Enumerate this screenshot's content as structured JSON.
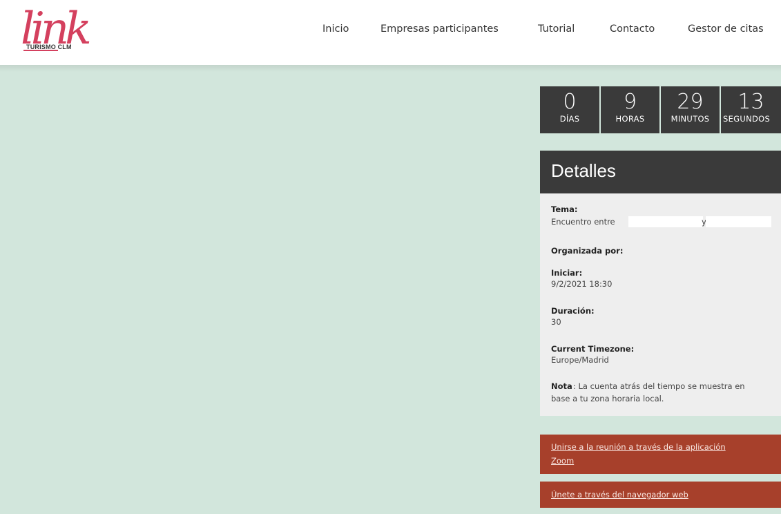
{
  "logo": {
    "script_text": "link",
    "sub_text": "TURISMO CLM"
  },
  "nav": {
    "items": [
      "Inicio",
      "Empresas participantes",
      "Tutorial",
      "Contacto",
      "Gestor de citas"
    ]
  },
  "countdown": {
    "cells": [
      {
        "value": "0",
        "label": "DÍAS"
      },
      {
        "value": "9",
        "label": "HORAS"
      },
      {
        "value": "29",
        "label": "MINUTOS"
      },
      {
        "value": "13",
        "label": "SEGUNDOS"
      }
    ]
  },
  "details": {
    "title": "Detalles",
    "topic_label": "Tema:",
    "topic_prefix": "Encuentro entre",
    "topic_joiner": "y",
    "organizer_label": "Organizada por:",
    "start_label": "Iniciar:",
    "start_value": "9/2/2021 18:30",
    "duration_label": "Duración:",
    "duration_value": "30",
    "timezone_label": "Current Timezone:",
    "timezone_value": "Europe/Madrid",
    "note_label": "Nota",
    "note_text_1": ": La cuenta atrás del tiempo se muestra en",
    "note_text_2": "base a tu zona horaria local."
  },
  "buttons": {
    "zoom_app_line1": "Unirse a la reunión a través de la aplicación",
    "zoom_app_line2": "Zoom",
    "web_browser": "Únete a través del navegador web"
  },
  "colors": {
    "brand_pink": "#d4405e",
    "hero_bg": "#d2e6dc",
    "dark_panel": "#3a3a3a",
    "details_bg": "#eeeeee",
    "action_red": "#a7402b"
  }
}
